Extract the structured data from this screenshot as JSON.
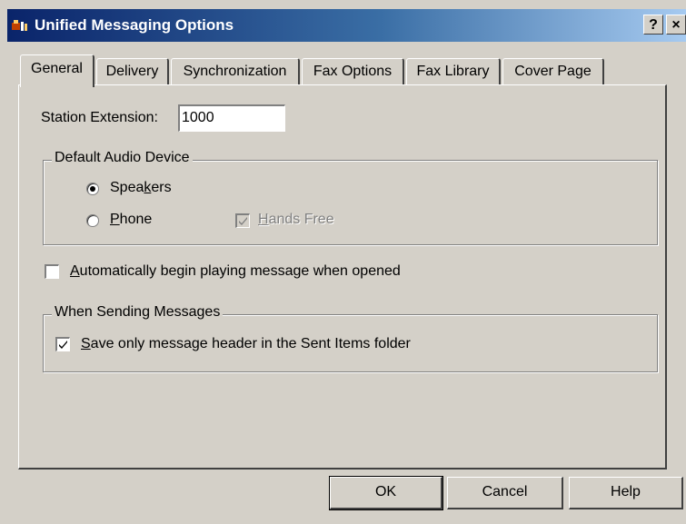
{
  "window": {
    "title": "Unified Messaging Options",
    "help_button": "?",
    "close_button": "×"
  },
  "tabs": [
    {
      "label": "General",
      "active": true
    },
    {
      "label": "Delivery"
    },
    {
      "label": "Synchronization"
    },
    {
      "label": "Fax Options"
    },
    {
      "label": "Fax Library"
    },
    {
      "label": "Cover Page"
    }
  ],
  "general": {
    "station_extension_label": "Station Extension:",
    "station_extension_value": "1000",
    "audio_group_label": "Default Audio Device",
    "speakers_label": "Speakers",
    "speakers_selected": true,
    "phone_label": "Phone",
    "phone_selected": false,
    "hands_free_label": "Hands Free",
    "hands_free_checked": true,
    "hands_free_enabled": false,
    "auto_play_label": "Automatically begin playing message when opened",
    "auto_play_checked": false,
    "sending_group_label": "When Sending Messages",
    "save_header_label": "Save only message header in the Sent Items folder",
    "save_header_checked": true
  },
  "buttons": {
    "ok": "OK",
    "cancel": "Cancel",
    "help": "Help"
  }
}
